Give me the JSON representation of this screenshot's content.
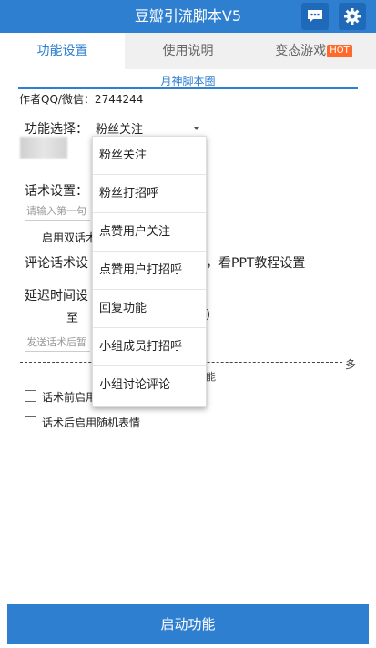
{
  "app": {
    "title": "豆瓣引流脚本V5",
    "accent": "#2f7fd1",
    "hot_color": "#ff6a2b"
  },
  "toolbar": {
    "chat_icon": "chat-bubble-icon",
    "settings_icon": "gear-icon"
  },
  "tabs": [
    {
      "label": "功能设置",
      "active": true
    },
    {
      "label": "使用说明",
      "active": false
    },
    {
      "label": "变态游戏",
      "badge": "HOT",
      "active": false
    }
  ],
  "banner": "月神脚本圈",
  "author": "作者QQ/微信：2744244",
  "function_select": {
    "label": "功能选择：",
    "selected": "粉丝关注"
  },
  "speech": {
    "label": "话术设置：",
    "placeholder": "请输入第一句",
    "dual_label": "启用双话术"
  },
  "comment": {
    "label": "评论话术设",
    "hint": "，看PPT教程设置"
  },
  "delay": {
    "label": "延迟时间设",
    "to": "至",
    "paren": ")",
    "after_placeholder": "发送话术后暂"
  },
  "more_suffix": "多",
  "feature_suffix": "能",
  "options": {
    "pre_random": "话术前启用",
    "post_random": "话术后启用随机表情"
  },
  "dropdown_items": [
    "粉丝关注",
    "粉丝打招呼",
    "点赞用户关注",
    "点赞用户打招呼",
    "回复功能",
    "小组成员打招呼",
    "小组讨论评论"
  ],
  "start_button": "启动功能"
}
